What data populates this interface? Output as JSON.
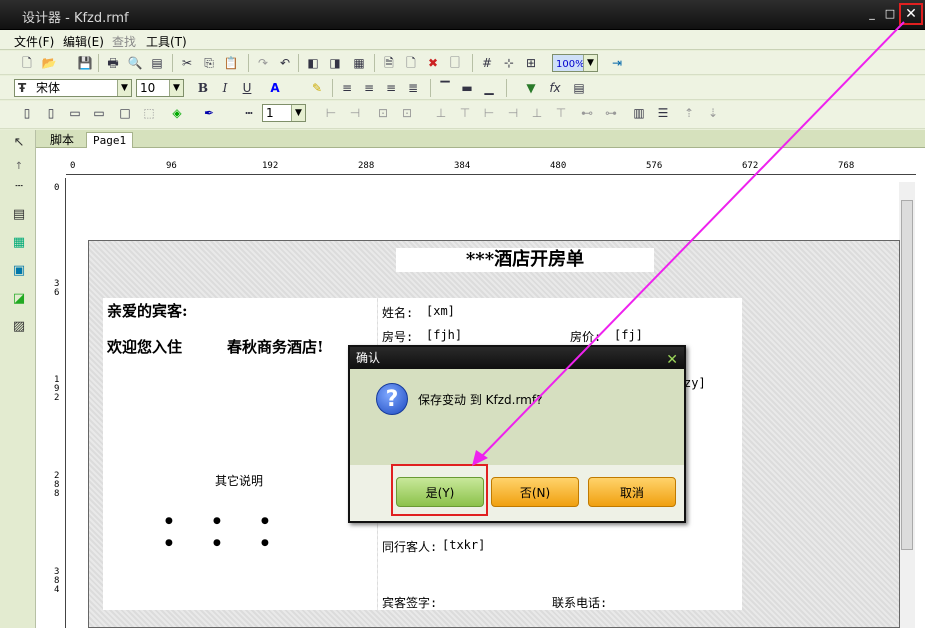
{
  "window": {
    "title": "设计器 - Kfzd.rmf",
    "minimize": "_",
    "maximize": "□",
    "close": "✕"
  },
  "menu": [
    "文件(F)",
    "编辑(E)",
    "查找",
    "工具(T)"
  ],
  "format": {
    "font_name": "宋体",
    "font_size": "10",
    "zoom": "100%",
    "line_width": "1"
  },
  "tabs": [
    "脚本",
    "Page1"
  ],
  "ruler": {
    "h": [
      "0",
      "96",
      "192",
      "288",
      "384",
      "480",
      "576",
      "672",
      "768"
    ],
    "v": [
      "0",
      "3\n6",
      "1\n9\n2",
      "2\n8\n8",
      "3\n8\n4"
    ]
  },
  "report": {
    "title": "***酒店开房单",
    "greeting": "亲爱的宾客:",
    "welcome": "欢迎您入住",
    "hotel": "春秋商务酒店!",
    "other": "其它说明",
    "name_label": "姓名:",
    "name_field": "[xm]",
    "room_label": "房号:",
    "room_field": "[fjh]",
    "price_label": "房价:",
    "price_field": "[fj]",
    "zy_field": "zy]",
    "companion_label": "同行客人:",
    "companion_field": "[txkr]",
    "sign_label": "宾客签字:",
    "phone_label": "联系电话:"
  },
  "dialog": {
    "title": "确认",
    "close": "✕",
    "icon": "?",
    "message": "保存变动 到 Kfzd.rmf?",
    "yes": "是(Y)",
    "no": "否(N)",
    "cancel": "取消"
  }
}
